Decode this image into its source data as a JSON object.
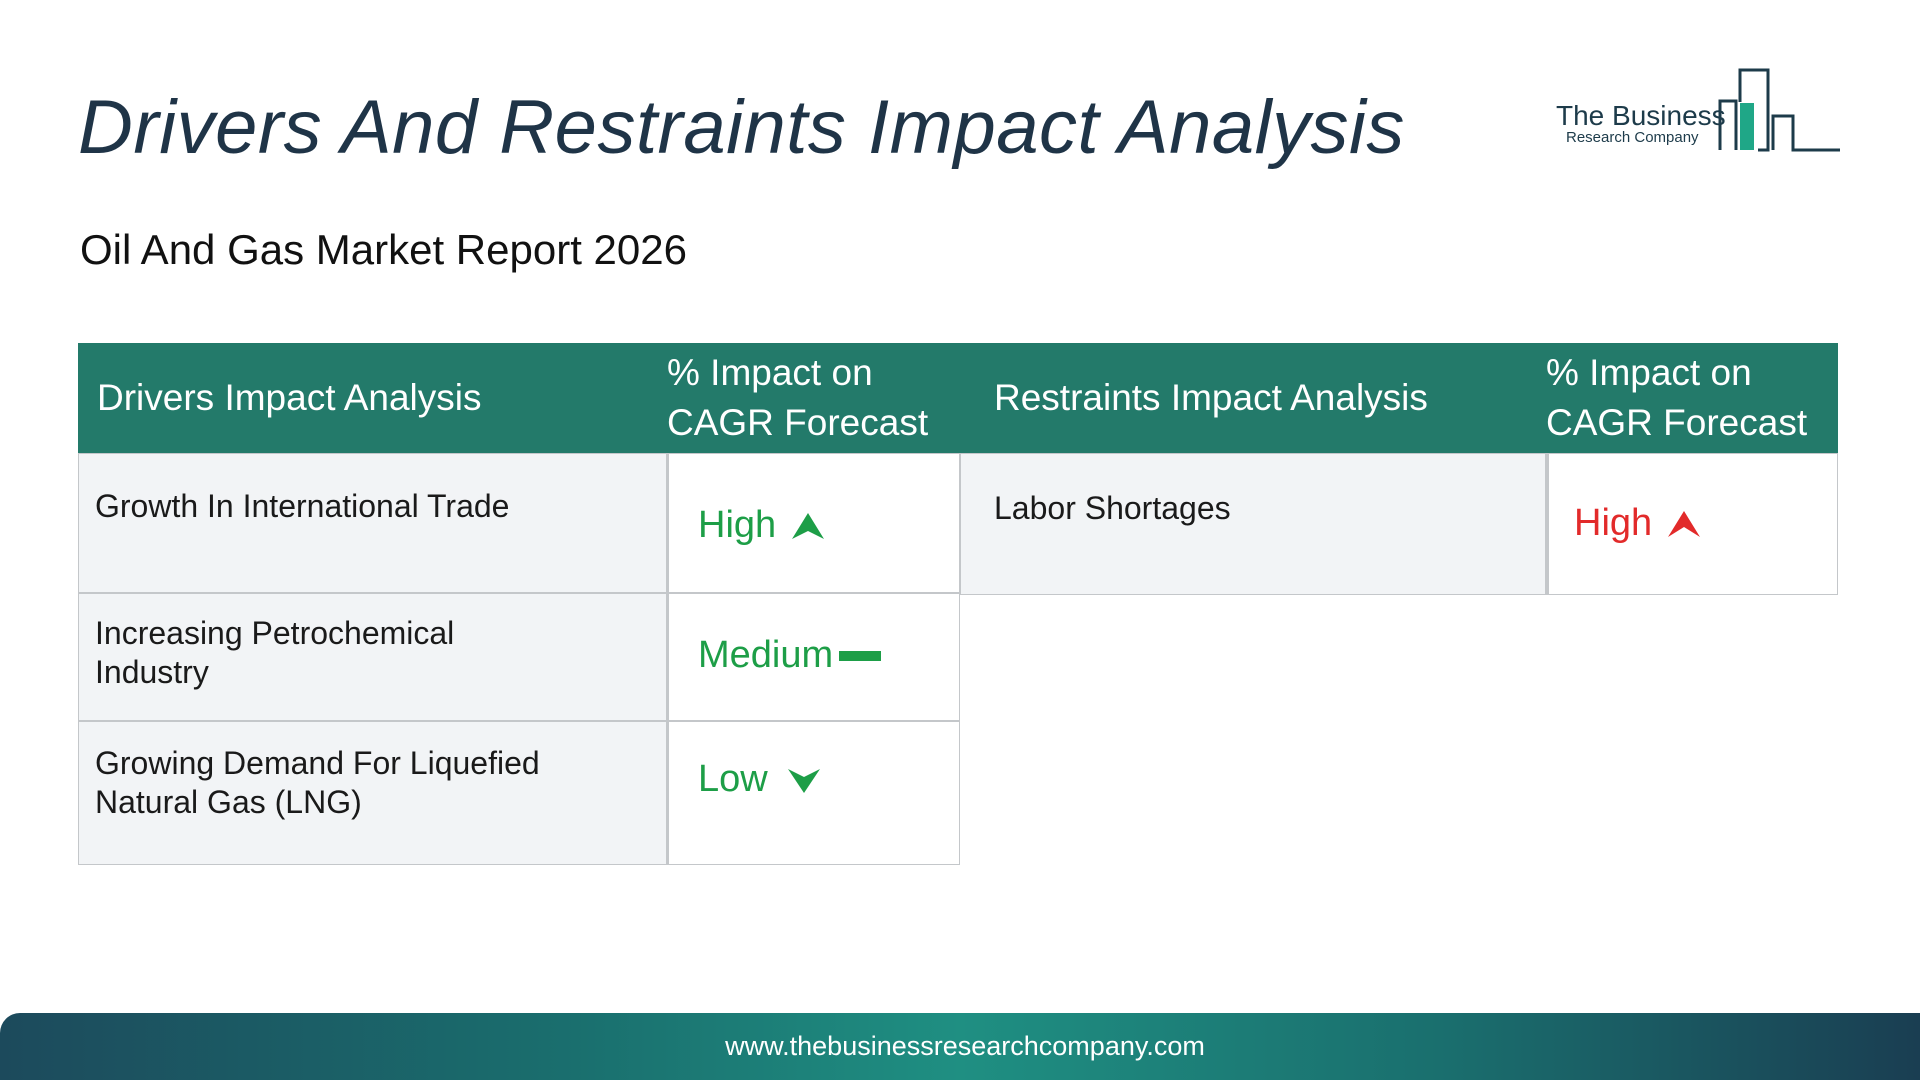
{
  "page_title": "Drivers And Restraints Impact Analysis",
  "subtitle": "Oil And Gas Market Report 2026",
  "logo": {
    "line1": "The Business",
    "line2": "Research Company"
  },
  "drivers_table": {
    "header_name": "Drivers Impact Analysis",
    "header_impact_line1": "% Impact on",
    "header_impact_line2": "CAGR Forecast",
    "rows": [
      {
        "name": "Growth In International Trade",
        "impact": "High",
        "icon": "arrow-up-icon",
        "color": "#1d9e47"
      },
      {
        "name_line1": "Increasing Petrochemical",
        "name_line2": "Industry",
        "impact": "Medium",
        "icon": "dash-icon",
        "color": "#1d9e47"
      },
      {
        "name_line1": "Growing Demand For Liquefied",
        "name_line2": "Natural Gas (LNG)",
        "impact": "Low",
        "icon": "chevron-down-icon",
        "color": "#1d9e47"
      }
    ]
  },
  "restraints_table": {
    "header_name": "Restraints Impact Analysis",
    "header_impact_line1": "% Impact on",
    "header_impact_line2": "CAGR Forecast",
    "rows": [
      {
        "name": "Labor Shortages",
        "impact": "High",
        "icon": "arrow-up-icon",
        "color": "#e22a2a"
      }
    ]
  },
  "footer": {
    "url": "www.thebusinessresearchcompany.com"
  },
  "colors": {
    "header_bg": "#237a6a",
    "title": "#1f3447",
    "positive": "#1d9e47",
    "negative": "#e22a2a"
  }
}
